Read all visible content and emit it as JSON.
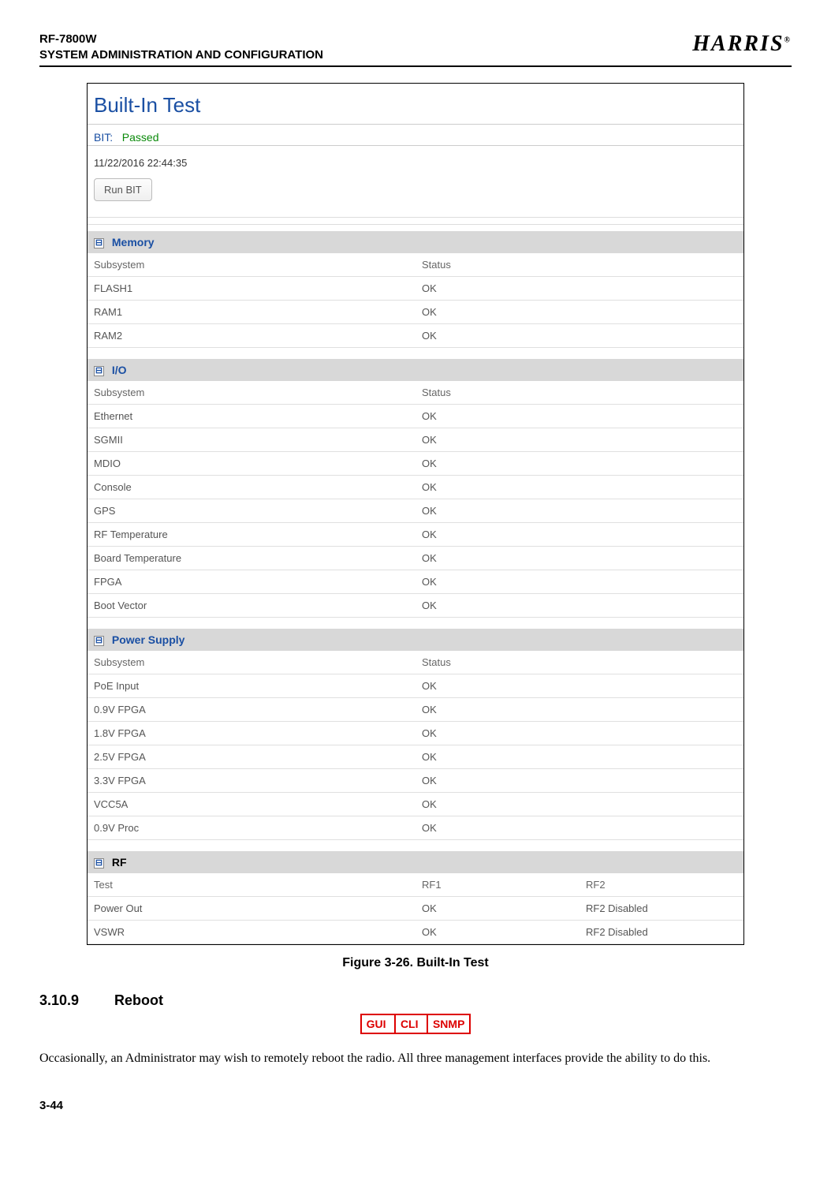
{
  "header": {
    "line1": "RF-7800W",
    "line2": "SYSTEM ADMINISTRATION AND CONFIGURATION",
    "brand": "HARRIS",
    "reg": "®"
  },
  "bit": {
    "title": "Built-In Test",
    "label": "BIT:",
    "status": "Passed",
    "timestamp": "11/22/2016    22:44:35",
    "run_label": "Run BIT"
  },
  "sections": {
    "memory": {
      "title": "Memory",
      "col1": "Subsystem",
      "col2": "Status",
      "rows": [
        {
          "name": "FLASH1",
          "status": "OK"
        },
        {
          "name": "RAM1",
          "status": "OK"
        },
        {
          "name": "RAM2",
          "status": "OK"
        }
      ]
    },
    "io": {
      "title": "I/O",
      "col1": "Subsystem",
      "col2": "Status",
      "rows": [
        {
          "name": "Ethernet",
          "status": "OK"
        },
        {
          "name": "SGMII",
          "status": "OK"
        },
        {
          "name": "MDIO",
          "status": "OK"
        },
        {
          "name": "Console",
          "status": "OK"
        },
        {
          "name": "GPS",
          "status": "OK"
        },
        {
          "name": "RF Temperature",
          "status": "OK"
        },
        {
          "name": "Board Temperature",
          "status": "OK"
        },
        {
          "name": "FPGA",
          "status": "OK"
        },
        {
          "name": "Boot Vector",
          "status": "OK"
        }
      ]
    },
    "power": {
      "title": "Power Supply",
      "col1": "Subsystem",
      "col2": "Status",
      "rows": [
        {
          "name": "PoE Input",
          "status": "OK"
        },
        {
          "name": "0.9V FPGA",
          "status": "OK"
        },
        {
          "name": "1.8V FPGA",
          "status": "OK"
        },
        {
          "name": "2.5V FPGA",
          "status": "OK"
        },
        {
          "name": "3.3V FPGA",
          "status": "OK"
        },
        {
          "name": "VCC5A",
          "status": "OK"
        },
        {
          "name": "0.9V Proc",
          "status": "OK"
        }
      ]
    },
    "rf": {
      "title": "RF",
      "col1": "Test",
      "col2": "RF1",
      "col3": "RF2",
      "rows": [
        {
          "name": "Power Out",
          "rf1": "OK",
          "rf2": "RF2 Disabled"
        },
        {
          "name": "VSWR",
          "rf1": "OK",
          "rf2": "RF2 Disabled"
        }
      ]
    }
  },
  "figure_caption": "Figure 3-26.  Built-In Test",
  "reboot": {
    "num": "3.10.9",
    "title": "Reboot",
    "badges": [
      "GUI",
      "CLI",
      "SNMP"
    ],
    "body": "Occasionally, an Administrator may wish to remotely reboot the radio. All three management interfaces provide the ability to do this."
  },
  "page_num": "3-44",
  "toggle_glyph": "⊟"
}
